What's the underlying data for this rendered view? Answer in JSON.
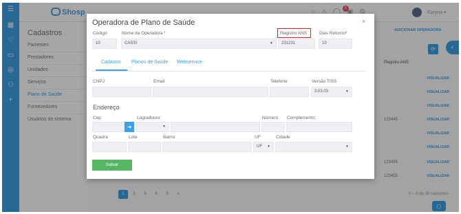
{
  "app": {
    "logo_text": "Shosp",
    "notification_count": "6",
    "username": "Karyna"
  },
  "sidebar": {
    "icons": [
      "menu-icon",
      "calendar-icon",
      "heart-icon",
      "money-icon",
      "database-icon",
      "people-icon",
      "plus-icon"
    ]
  },
  "left_menu": {
    "title": "Cadastros",
    "items": [
      "Pacientes",
      "Prestadores",
      "Unidades",
      "Serviços",
      "Plano de Saúde",
      "Fornecedores",
      "Usuários do sistema"
    ],
    "active_index": 4
  },
  "background": {
    "add_button": "ADICIONAR OPERADORA",
    "column_header": "Registro ANS",
    "ans_values": [
      "123445",
      "123455",
      "123455"
    ],
    "action_label": "VISUALIZAR",
    "pages": [
      "1",
      "2",
      "3",
      "4",
      "5",
      "»"
    ],
    "active_page": "1",
    "count_text": "0 – 8 de 36 cadastros"
  },
  "modal": {
    "title": "Operadora de Plano de Saúde",
    "fields": {
      "codigo": {
        "label": "Código",
        "value": "10"
      },
      "nome": {
        "label": "Nome da Operadora *",
        "value": "CASSI"
      },
      "registro_ans": {
        "label": "Registro ANS",
        "value": "231231"
      },
      "dias_retorno": {
        "label": "Dias Retorno*",
        "value": "10"
      },
      "cnpj": {
        "label": "CNPJ",
        "value": ""
      },
      "email": {
        "label": "Email",
        "value": ""
      },
      "telefone": {
        "label": "Telefone",
        "value": ""
      },
      "versao_tiss": {
        "label": "Versão TISS",
        "value": "3.03.03"
      },
      "cep": {
        "label": "Cep",
        "value": ""
      },
      "logradouro": {
        "label": "Logradouro:",
        "value": ""
      },
      "numero": {
        "label": "Número",
        "value": ""
      },
      "complemento": {
        "label": "Complemento:",
        "value": ""
      },
      "quadra": {
        "label": "Quadra",
        "value": ""
      },
      "lote": {
        "label": "Lote",
        "value": ""
      },
      "bairro": {
        "label": "Bairro",
        "value": ""
      },
      "uf": {
        "label": "UF",
        "value": "UF"
      },
      "cidade": {
        "label": "Cidade",
        "value": ""
      }
    },
    "tabs": [
      "Cadastro",
      "Planos de Saúde",
      "Webservice"
    ],
    "active_tab": "Cadastro",
    "section_endereco": "Endereço",
    "save_label": "Salvar",
    "close_label": "×",
    "highlight_color": "#e02424"
  }
}
